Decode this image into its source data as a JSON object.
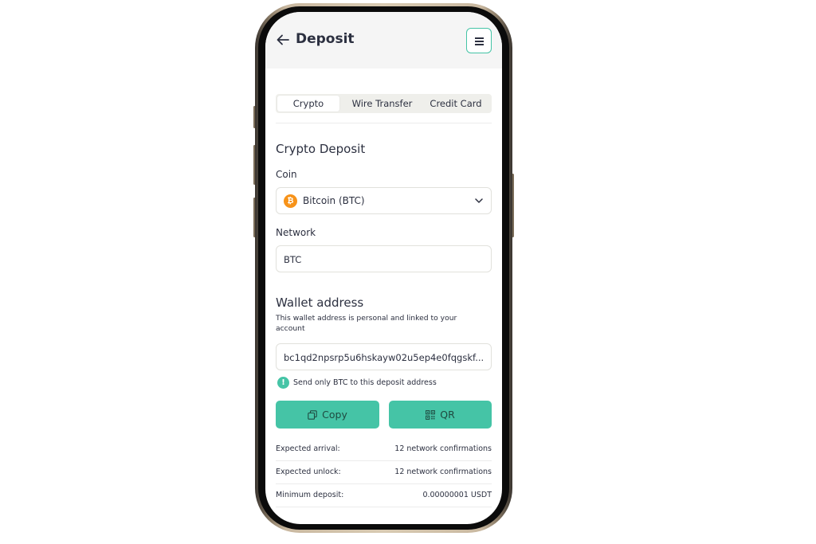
{
  "header": {
    "title": "Deposit"
  },
  "tabs": [
    {
      "label": "Crypto",
      "active": true
    },
    {
      "label": "Wire Transfer",
      "active": false
    },
    {
      "label": "Credit Card",
      "active": false
    }
  ],
  "crypto_deposit": {
    "title": "Crypto Deposit",
    "coin_label": "Coin",
    "coin_value": "Bitcoin (BTC)",
    "coin_icon": "bitcoin-icon",
    "network_label": "Network",
    "network_value": "BTC"
  },
  "wallet": {
    "title": "Wallet address",
    "description": "This wallet address is personal and linked to your account",
    "address": "bc1qd2npsrp5u6hskayw02u5ep4e0fqgskf...",
    "notice": "Send only BTC to this deposit address"
  },
  "actions": {
    "copy_label": "Copy",
    "qr_label": "QR"
  },
  "info": [
    {
      "label": "Expected arrival:",
      "value": "12 network confirmations"
    },
    {
      "label": "Expected unlock:",
      "value": "12 network confirmations"
    },
    {
      "label": "Minimum deposit:",
      "value": "0.00000001 USDT"
    }
  ],
  "colors": {
    "accent": "#45c4a6",
    "bitcoin": "#f7931a",
    "text": "#2c3040"
  }
}
